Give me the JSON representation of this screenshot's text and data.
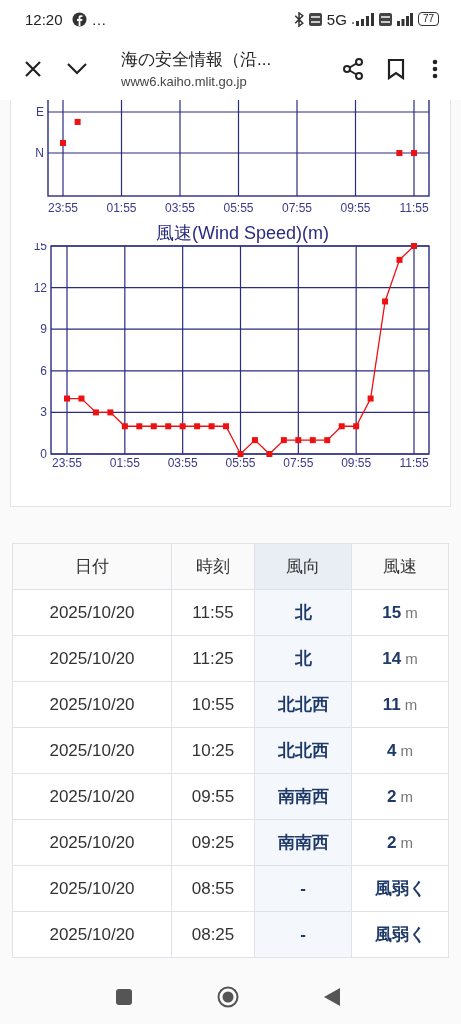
{
  "status_bar": {
    "time": "12:20",
    "more": "…",
    "network": "5G",
    "battery": "77"
  },
  "toolbar": {
    "title": "海の安全情報（沿...",
    "url": "www6.kaiho.mlit.go.jp"
  },
  "direction_chart": {
    "y_labels": [
      "E",
      "N"
    ],
    "x_labels": [
      "23:55",
      "01:55",
      "03:55",
      "05:55",
      "07:55",
      "09:55",
      "11:55"
    ]
  },
  "speed_chart": {
    "chart_data": {
      "type": "line",
      "title": "風速(Wind Speed)(m)",
      "categories": [
        "23:55",
        null,
        null,
        null,
        "01:55",
        null,
        null,
        null,
        "03:55",
        null,
        null,
        null,
        "05:55",
        null,
        null,
        null,
        "07:55",
        null,
        null,
        null,
        "09:55",
        null,
        null,
        null,
        "11:55"
      ],
      "series": [
        {
          "color": "#ee1111",
          "marker": "square",
          "values": [
            4,
            4,
            3,
            3,
            2,
            2,
            2,
            2,
            2,
            2,
            2,
            2,
            0,
            1,
            0,
            1,
            1,
            1,
            1,
            2,
            2,
            4,
            11,
            14,
            15
          ]
        }
      ],
      "ylim": [
        0,
        15
      ],
      "yticks": [
        0,
        3,
        6,
        9,
        12,
        15
      ],
      "grid": true
    }
  },
  "table": {
    "columns": [
      {
        "label": "日付",
        "highlighted": false
      },
      {
        "label": "時刻",
        "highlighted": false
      },
      {
        "label": "風向",
        "highlighted": true
      },
      {
        "label": "風速",
        "highlighted": false
      }
    ],
    "rows": [
      {
        "date": "2025/10/20",
        "time": "11:55",
        "direction": "北",
        "speed": "**15** m"
      },
      {
        "date": "2025/10/20",
        "time": "11:25",
        "direction": "北",
        "speed": "**14** m"
      },
      {
        "date": "2025/10/20",
        "time": "10:55",
        "direction": "北北西",
        "speed": "**11** m"
      },
      {
        "date": "2025/10/20",
        "time": "10:25",
        "direction": "北北西",
        "speed": "**4** m"
      },
      {
        "date": "2025/10/20",
        "time": "09:55",
        "direction": "南南西",
        "speed": "**2** m"
      },
      {
        "date": "2025/10/20",
        "time": "09:25",
        "direction": "南南西",
        "speed": "**2** m"
      },
      {
        "date": "2025/10/20",
        "time": "08:55",
        "direction": "-",
        "speed": "**風弱く**"
      },
      {
        "date": "2025/10/20",
        "time": "08:25",
        "direction": "-",
        "speed": "**風弱く**"
      }
    ]
  }
}
